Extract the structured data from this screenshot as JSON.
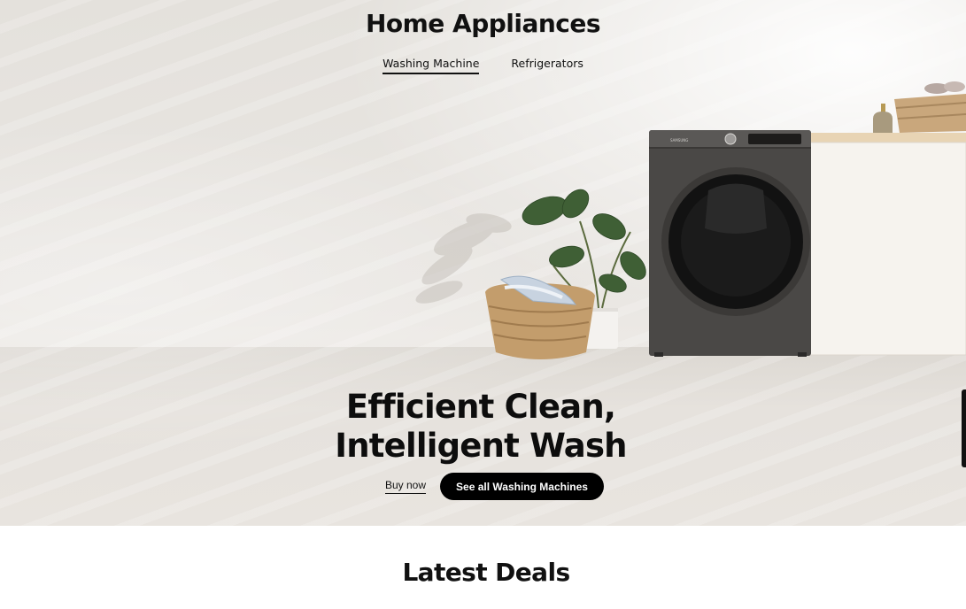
{
  "hero": {
    "heading": "Home Appliances",
    "tabs": [
      {
        "label": "Washing Machine",
        "active": true
      },
      {
        "label": "Refrigerators",
        "active": false
      }
    ],
    "headline_line1": "Efficient Clean,",
    "headline_line2": "Intelligent Wash",
    "buy_label": "Buy now",
    "see_all_label": "See all Washing Machines",
    "washer_brand": "SAMSUNG"
  },
  "deals": {
    "title": "Latest Deals"
  },
  "colors": {
    "button_bg": "#000000",
    "button_text": "#ffffff",
    "washer_body": "#4a4846"
  }
}
